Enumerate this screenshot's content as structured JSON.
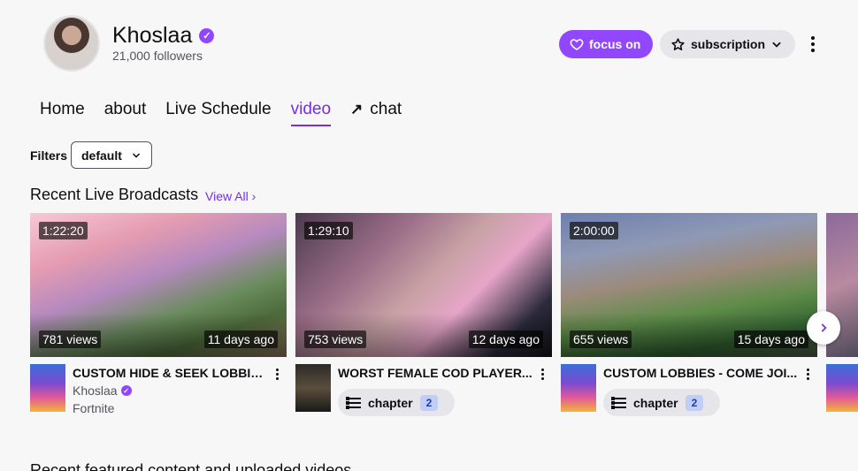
{
  "channel": {
    "name": "Khoslaa",
    "followers": "21,000 followers"
  },
  "actions": {
    "follow_label": "focus on",
    "subscribe_label": "subscription"
  },
  "tabs": [
    {
      "label": "Home"
    },
    {
      "label": "about"
    },
    {
      "label": "Live Schedule"
    },
    {
      "label": "video",
      "active": true
    },
    {
      "label": "chat",
      "icon": "external-arrow-icon"
    }
  ],
  "filters": {
    "label": "Filters",
    "selected": "default"
  },
  "section": {
    "title": "Recent Live Broadcasts",
    "view_all": "View All"
  },
  "videos": [
    {
      "duration": "1:22:20",
      "views": "781 views",
      "age": "11 days ago",
      "title": "CUSTOM HIDE & SEEK LOBBIE...",
      "streamer": "Khoslaa",
      "category": "Fortnite",
      "game": "fortnite-box-art"
    },
    {
      "duration": "1:29:10",
      "views": "753 views",
      "age": "12 days ago",
      "title": "WORST FEMALE COD PLAYER...",
      "chapter_label": "chapter",
      "chapter_count": "2",
      "game": "call-of-duty-box-art"
    },
    {
      "duration": "2:00:00",
      "views": "655 views",
      "age": "15 days ago",
      "title": "CUSTOM LOBBIES - COME JOI...",
      "chapter_label": "chapter",
      "chapter_count": "2",
      "game": "fortnite-box-art"
    }
  ],
  "bottom_section": {
    "title": "Recent featured content and uploaded videos"
  },
  "colors": {
    "accent": "#9147ff",
    "accent_text": "#772ce8",
    "background": "#f7f7f8"
  }
}
